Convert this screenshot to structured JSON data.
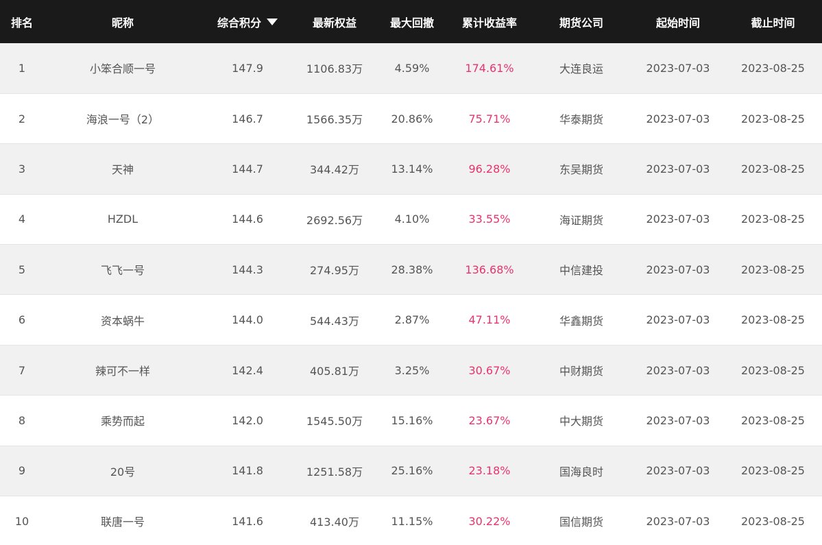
{
  "table": {
    "headers": {
      "rank": "排名",
      "nickname": "昵称",
      "score": "综合积分",
      "equity": "最新权益",
      "drawdown": "最大回撤",
      "return_rate": "累计收益率",
      "company": "期货公司",
      "start": "起始时间",
      "end": "截止时间"
    },
    "sort_indicator": "chevron-down-icon",
    "colors": {
      "header_bg": "#1a1a1a",
      "return_rate_text": "#e8336d",
      "row_alt_bg": "#f1f1f1"
    },
    "rows": [
      {
        "rank": "1",
        "nickname": "小笨合顺一号",
        "score": "147.9",
        "equity": "1106.83万",
        "drawdown": "4.59%",
        "return_rate": "174.61%",
        "company": "大连良运",
        "start": "2023-07-03",
        "end": "2023-08-25"
      },
      {
        "rank": "2",
        "nickname": "海浪一号（2）",
        "score": "146.7",
        "equity": "1566.35万",
        "drawdown": "20.86%",
        "return_rate": "75.71%",
        "company": "华泰期货",
        "start": "2023-07-03",
        "end": "2023-08-25"
      },
      {
        "rank": "3",
        "nickname": "天神",
        "score": "144.7",
        "equity": "344.42万",
        "drawdown": "13.14%",
        "return_rate": "96.28%",
        "company": "东吴期货",
        "start": "2023-07-03",
        "end": "2023-08-25"
      },
      {
        "rank": "4",
        "nickname": "HZDL",
        "score": "144.6",
        "equity": "2692.56万",
        "drawdown": "4.10%",
        "return_rate": "33.55%",
        "company": "海证期货",
        "start": "2023-07-03",
        "end": "2023-08-25"
      },
      {
        "rank": "5",
        "nickname": "飞飞一号",
        "score": "144.3",
        "equity": "274.95万",
        "drawdown": "28.38%",
        "return_rate": "136.68%",
        "company": "中信建投",
        "start": "2023-07-03",
        "end": "2023-08-25"
      },
      {
        "rank": "6",
        "nickname": "资本蜗牛",
        "score": "144.0",
        "equity": "544.43万",
        "drawdown": "2.87%",
        "return_rate": "47.11%",
        "company": "华鑫期货",
        "start": "2023-07-03",
        "end": "2023-08-25"
      },
      {
        "rank": "7",
        "nickname": "辣可不一样",
        "score": "142.4",
        "equity": "405.81万",
        "drawdown": "3.25%",
        "return_rate": "30.67%",
        "company": "中财期货",
        "start": "2023-07-03",
        "end": "2023-08-25"
      },
      {
        "rank": "8",
        "nickname": "乘势而起",
        "score": "142.0",
        "equity": "1545.50万",
        "drawdown": "15.16%",
        "return_rate": "23.67%",
        "company": "中大期货",
        "start": "2023-07-03",
        "end": "2023-08-25"
      },
      {
        "rank": "9",
        "nickname": "20号",
        "score": "141.8",
        "equity": "1251.58万",
        "drawdown": "25.16%",
        "return_rate": "23.18%",
        "company": "国海良时",
        "start": "2023-07-03",
        "end": "2023-08-25"
      },
      {
        "rank": "10",
        "nickname": "联唐一号",
        "score": "141.6",
        "equity": "413.40万",
        "drawdown": "11.15%",
        "return_rate": "30.22%",
        "company": "国信期货",
        "start": "2023-07-03",
        "end": "2023-08-25"
      }
    ]
  }
}
